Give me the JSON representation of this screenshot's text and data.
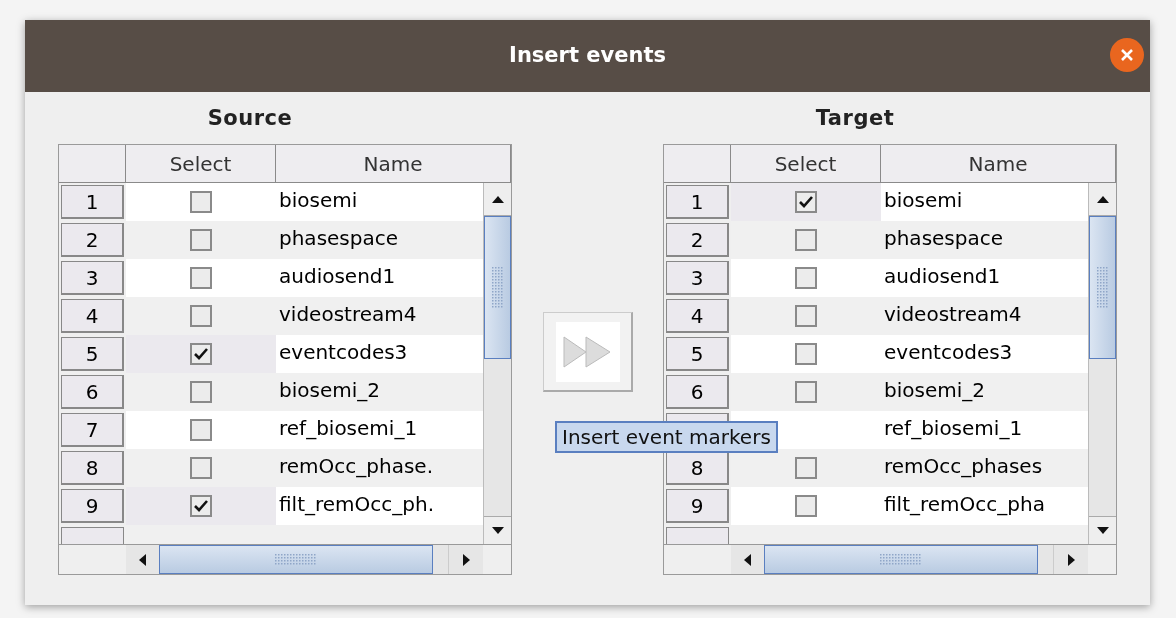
{
  "dialog": {
    "title": "Insert events"
  },
  "source": {
    "title": "Source",
    "columns": [
      "Select",
      "Name"
    ],
    "rows": [
      {
        "number": "1",
        "checked": false,
        "name": "biosemi"
      },
      {
        "number": "2",
        "checked": false,
        "name": "phasespace"
      },
      {
        "number": "3",
        "checked": false,
        "name": "audiosend1"
      },
      {
        "number": "4",
        "checked": false,
        "name": "videostream4"
      },
      {
        "number": "5",
        "checked": true,
        "name": "eventcodes3"
      },
      {
        "number": "6",
        "checked": false,
        "name": "biosemi_2"
      },
      {
        "number": "7",
        "checked": false,
        "name": "ref_biosemi_1"
      },
      {
        "number": "8",
        "checked": false,
        "name": "remOcc_phase."
      },
      {
        "number": "9",
        "checked": true,
        "name": "filt_remOcc_ph."
      }
    ]
  },
  "target": {
    "title": "Target",
    "columns": [
      "Select",
      "Name"
    ],
    "rows": [
      {
        "number": "1",
        "checked": true,
        "name": "biosemi"
      },
      {
        "number": "2",
        "checked": false,
        "name": "phasespace"
      },
      {
        "number": "3",
        "checked": false,
        "name": "audiosend1"
      },
      {
        "number": "4",
        "checked": false,
        "name": "videostream4"
      },
      {
        "number": "5",
        "checked": false,
        "name": "eventcodes3"
      },
      {
        "number": "6",
        "checked": false,
        "name": "biosemi_2"
      },
      {
        "name": "ref_biosemi_1"
      },
      {
        "number": "8",
        "checked": false,
        "name": "remOcc_phases"
      },
      {
        "number": "9",
        "checked": false,
        "name": "filt_remOcc_pha"
      }
    ]
  },
  "insert_button": {
    "tooltip": "Insert event markers"
  }
}
